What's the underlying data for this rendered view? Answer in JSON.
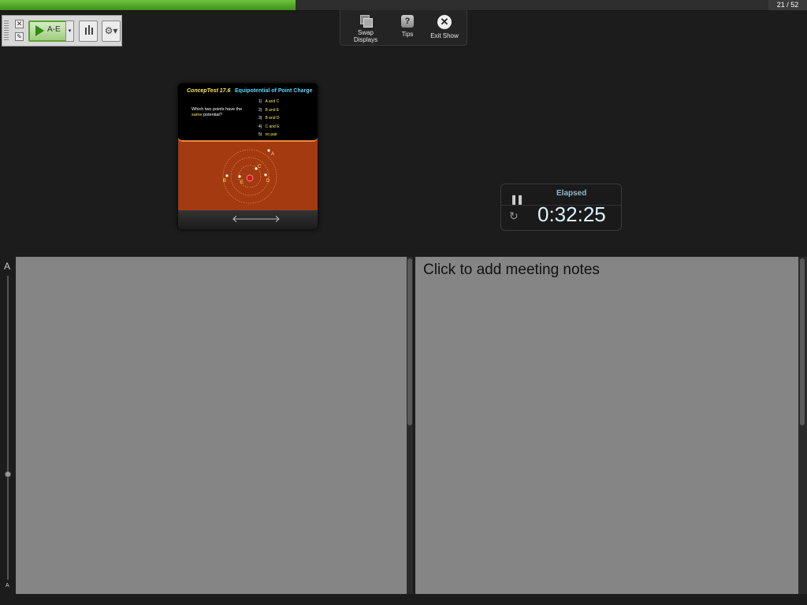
{
  "progress": {
    "current": 21,
    "total": 52,
    "fraction": 0.385,
    "counter_text": "21 / 52",
    "color": "#5fb52d"
  },
  "toolbar": {
    "play_label": "A-E",
    "play_accent": "#2f8c12",
    "drop_glyph": "▾",
    "close_glyph": "✕",
    "edit_glyph": "✎",
    "settings_glyph": "⚙▾"
  },
  "top_menu": {
    "swap_label": "Swap Displays",
    "tips_label": "Tips",
    "tips_glyph": "?",
    "exit_label": "Exit Show",
    "exit_glyph": "✕"
  },
  "slide": {
    "title": "ConcepTest 17.6",
    "subtitle": "Equipotential of Point Charge",
    "question_pre": "Which two points have the ",
    "question_hl": "same",
    "question_post": " potential?",
    "options": [
      {
        "num": "1)",
        "text": "A and C"
      },
      {
        "num": "2)",
        "text": "B and E"
      },
      {
        "num": "3)",
        "text": "B and D"
      },
      {
        "num": "4)",
        "text": "C and E"
      },
      {
        "num": "5)",
        "text": "no pair"
      }
    ],
    "point_labels": [
      "A",
      "B",
      "C",
      "D",
      "E"
    ],
    "prev_glyph": "🡐",
    "next_glyph": "🡒"
  },
  "timer": {
    "label": "Elapsed",
    "value": "0:32:25",
    "pause_glyph": "❚❚",
    "reset_glyph": "↻"
  },
  "font_slider": {
    "large": "A",
    "small": "A"
  },
  "notes": {
    "placeholder": "Click to add meeting notes"
  }
}
